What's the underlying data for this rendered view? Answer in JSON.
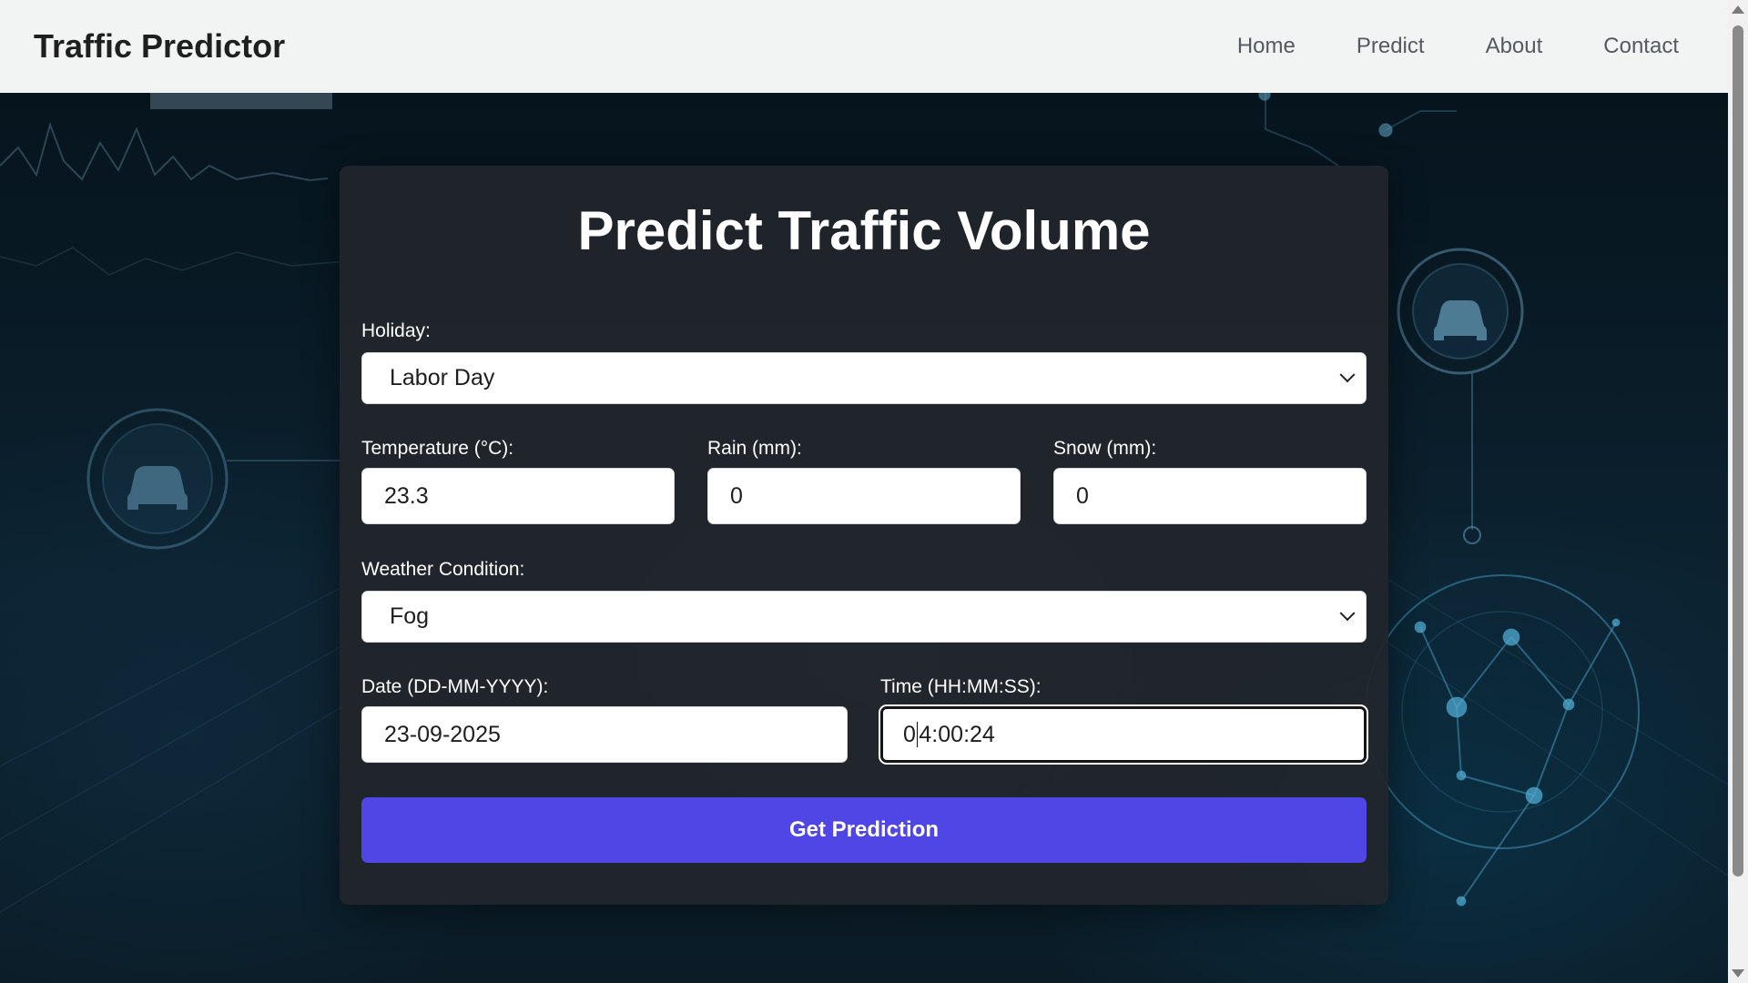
{
  "nav": {
    "brand": "Traffic Predictor",
    "links": [
      "Home",
      "Predict",
      "About",
      "Contact"
    ]
  },
  "form": {
    "title": "Predict Traffic Volume",
    "holiday": {
      "label": "Holiday:",
      "value": "Labor Day"
    },
    "temperature": {
      "label": "Temperature (°C):",
      "value": "23.3"
    },
    "rain": {
      "label": "Rain (mm):",
      "value": "0"
    },
    "snow": {
      "label": "Snow (mm):",
      "value": "0"
    },
    "weather": {
      "label": "Weather Condition:",
      "value": "Fog"
    },
    "date": {
      "label": "Date (DD-MM-YYYY):",
      "value": "23-09-2025"
    },
    "time": {
      "label": "Time (HH:MM:SS):",
      "value_before_caret": "0",
      "value_after_caret": "4:00:24"
    },
    "submit_label": "Get Prediction"
  },
  "colors": {
    "accent": "#4f46e5",
    "navbar_bg": "#f2f3f3",
    "card_bg": "#21262b"
  },
  "icons": [
    "car-icon",
    "chevron-down-icon"
  ]
}
